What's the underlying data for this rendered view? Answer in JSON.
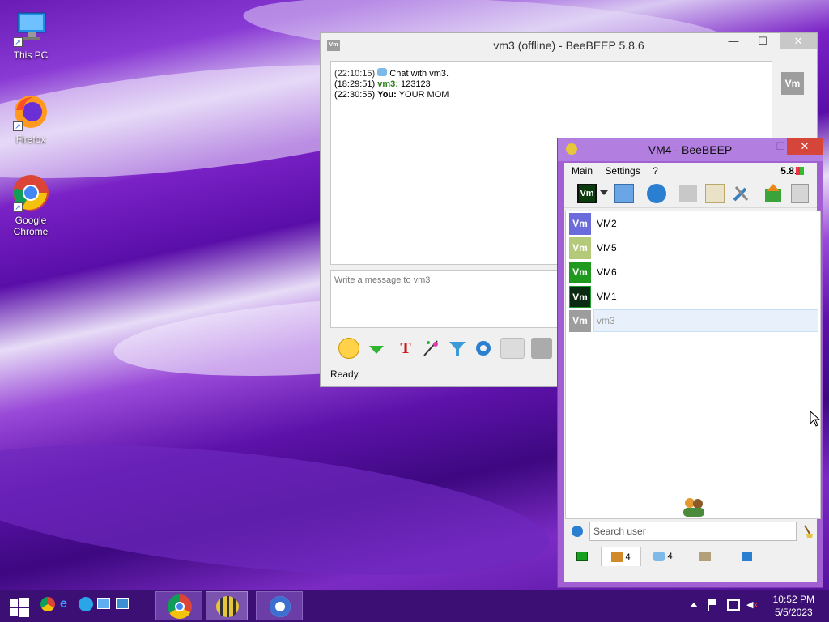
{
  "desktop": {
    "icons": [
      {
        "label": "This PC"
      },
      {
        "label": "Firefox"
      },
      {
        "label": "Google Chrome"
      }
    ]
  },
  "chat_window": {
    "title": "vm3 (offline) - BeeBEEP 5.8.6",
    "messages": [
      {
        "time": "(22:10:15)",
        "text": "Chat with vm3."
      },
      {
        "time": "(18:29:51)",
        "user": "vm3:",
        "text": "123123"
      },
      {
        "time": "(22:30:55)",
        "user": "You:",
        "text": "YOUR MOM"
      }
    ],
    "input_placeholder": "Write a message to vm3",
    "status": "Ready.",
    "side_avatar": "Vm"
  },
  "main_window": {
    "title": "VM4 - BeeBEEP",
    "menu": [
      "Main",
      "Settings",
      "?"
    ],
    "version": "5.8.6",
    "my_avatar": "Vm",
    "users": [
      {
        "avatar": "Vm",
        "name": "VM2",
        "color": "#6b6bdc"
      },
      {
        "avatar": "Vm",
        "name": "VM5",
        "color": "#b5c97a"
      },
      {
        "avatar": "Vm",
        "name": "VM6",
        "color": "#1f9a1f"
      },
      {
        "avatar": "Vm",
        "name": "VM1",
        "color": "#0a2a12"
      },
      {
        "avatar": "Vm",
        "name": "vm3",
        "color": "#9d9d9d"
      }
    ],
    "search_placeholder": "Search user",
    "tabs": [
      {
        "icon": "chat-green-icon",
        "count": ""
      },
      {
        "icon": "users-icon",
        "count": "4"
      },
      {
        "icon": "chats-icon",
        "count": "4"
      },
      {
        "icon": "group-icon",
        "count": ""
      },
      {
        "icon": "share-icon",
        "count": ""
      }
    ]
  },
  "taskbar": {
    "time": "10:52 PM",
    "date": "5/5/2023"
  }
}
